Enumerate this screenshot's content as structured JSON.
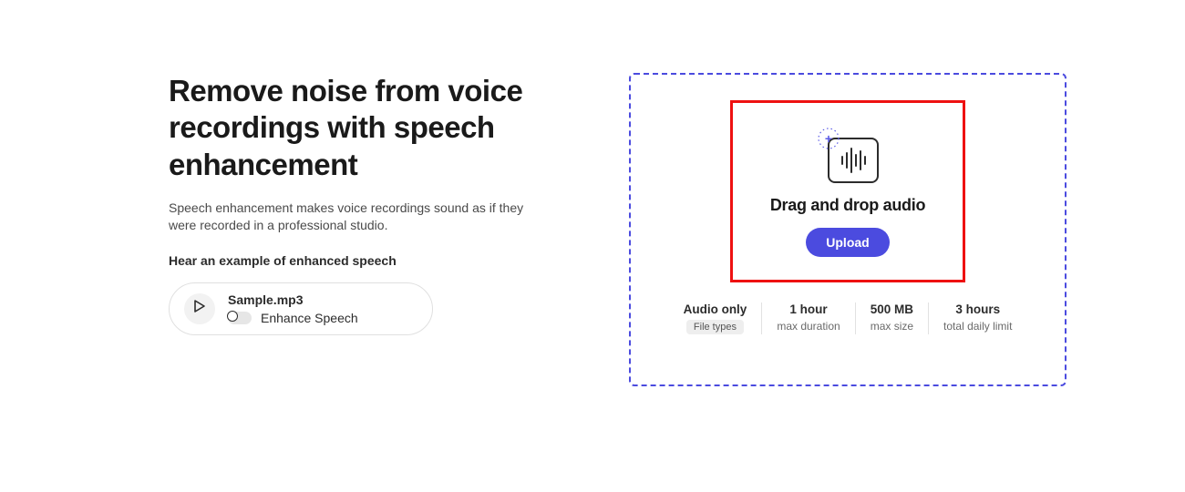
{
  "left": {
    "title": "Remove noise from voice recordings with speech enhancement",
    "description": "Speech enhancement makes voice recordings sound as if they were recorded in a professional studio.",
    "example_label": "Hear an example of enhanced speech",
    "sample": {
      "name": "Sample.mp3",
      "enhance_label": "Enhance Speech"
    }
  },
  "upload": {
    "dnd_text": "Drag and drop audio",
    "button_label": "Upload"
  },
  "specs": [
    {
      "top": "Audio only",
      "bottom": "File types",
      "is_tag": true
    },
    {
      "top": "1 hour",
      "bottom": "max duration",
      "is_tag": false
    },
    {
      "top": "500 MB",
      "bottom": "max size",
      "is_tag": false
    },
    {
      "top": "3 hours",
      "bottom": "total daily limit",
      "is_tag": false
    }
  ]
}
